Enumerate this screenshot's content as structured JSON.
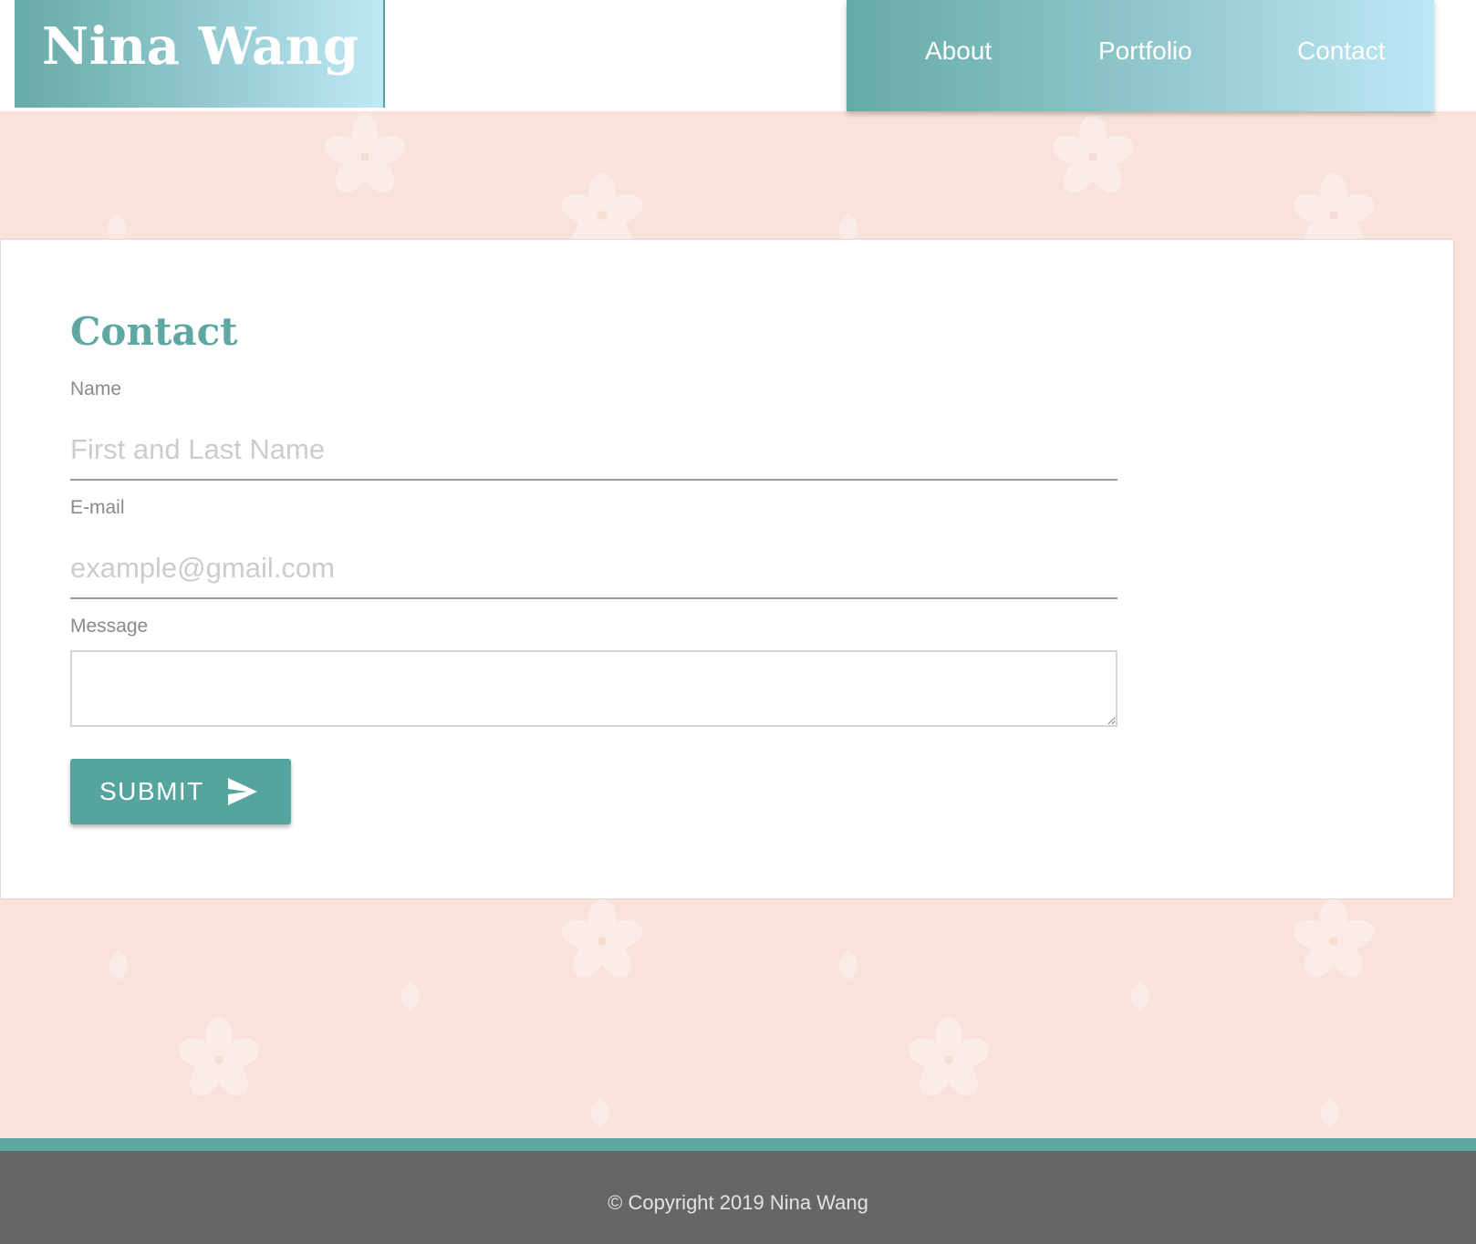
{
  "header": {
    "site_name": "Nina Wang",
    "nav": [
      {
        "label": "About"
      },
      {
        "label": "Portfolio"
      },
      {
        "label": "Contact"
      }
    ]
  },
  "contact_form": {
    "title": "Contact",
    "name_label": "Name",
    "name_placeholder": "First and Last Name",
    "name_value": "",
    "email_label": "E-mail",
    "email_placeholder": "example@gmail.com",
    "email_value": "",
    "message_label": "Message",
    "message_value": "",
    "submit_label": "SUBMIT",
    "submit_icon": "send-icon"
  },
  "footer": {
    "copyright": "© Copyright 2019 Nina Wang"
  },
  "colors": {
    "accent": "#5fa7a3",
    "button": "#56a49e",
    "background": "#f9e2da",
    "footer": "#666666",
    "nav_gradient_start": "#66aba7",
    "nav_gradient_end": "#bde8f6"
  },
  "decoration_icon": "cherry-blossom-icon"
}
